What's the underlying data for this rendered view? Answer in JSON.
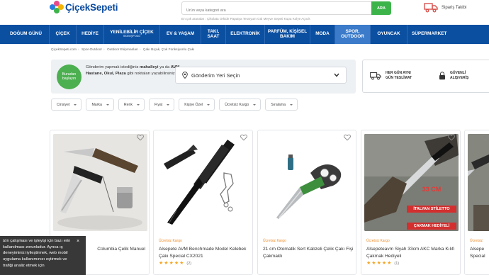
{
  "header": {
    "logo_text": "ÇiçekSepeti",
    "search_placeholder": "Ürün veya kategori ara",
    "search_button": "ARA",
    "recent_searches": "En çok aranalar : Çikolata Orkide Papatya Teraryum Gül Meyve Sepeti Kupa Kolye Açıcık",
    "order_tracking": "Sipariş Takibi"
  },
  "nav": {
    "items": [
      {
        "label": "DOĞUM GÜNÜ",
        "sub": ""
      },
      {
        "label": "ÇİÇEK",
        "sub": ""
      },
      {
        "label": "HEDİYE",
        "sub": ""
      },
      {
        "label": "YENİLEBİLİR ÇİÇEK",
        "sub": "BonnyFood"
      },
      {
        "label": "EV & YAŞAM",
        "sub": ""
      },
      {
        "label": "TAKI, SAAT",
        "sub": ""
      },
      {
        "label": "ELEKTRONİK",
        "sub": ""
      },
      {
        "label": "PARFÜM, KİŞİSEL BAKIM",
        "sub": ""
      },
      {
        "label": "MODA",
        "sub": ""
      },
      {
        "label": "SPOR, OUTDOOR",
        "sub": ""
      },
      {
        "label": "OYUNCAK",
        "sub": ""
      },
      {
        "label": "SÜPERMARKET",
        "sub": ""
      }
    ],
    "active_index": 9,
    "colors": {
      "bar": "#0b4fa1",
      "active": "#3b7bc9"
    }
  },
  "breadcrumb": [
    "ÇiçekSepeti.com",
    "Spor-Outdoor",
    "Outdoor Ekipmanları",
    "Çakı Bıçak, Çok Fonksiyonlu Çakı"
  ],
  "delivery": {
    "badge": "Buradan başlayın",
    "text_1": "Gönderim yapmak istediğiniz ",
    "text_bold_1": "mahalleyi",
    "text_2": " ya da ",
    "text_bold_2": "AVM, Hastane, Okul, Plaza",
    "text_3": " gibi noktaları yazabilirsiniz.",
    "location_placeholder": "Gönderim Yeri Seçin"
  },
  "features": {
    "same_day": "HER GÜN AYNI GÜN TESLİMAT",
    "secure": "GÜVENLİ ALIŞVERİŞ"
  },
  "filters": [
    "Cinsiyet",
    "Marka",
    "Renk",
    "Fiyat",
    "Kişiye Özel",
    "Ücretsiz Kargo",
    "Sıralama"
  ],
  "products": [
    {
      "shipping": "",
      "title": "Columbia Çelik Manuel",
      "rating": 0,
      "reviews": ""
    },
    {
      "shipping": "Ücretsiz Kargo",
      "title": "Alsepete AVM Benchmade Model Kelebek Çakı Special CX2021",
      "rating": 5,
      "reviews": "(2)"
    },
    {
      "shipping": "Ücretsiz Kargo",
      "title": "21 cm Otomatik Sert Kabzeli Çelik Çakı Fişi Çakmaklı",
      "rating": 0,
      "reviews": ""
    },
    {
      "shipping": "Ücretsiz Kargo",
      "title": "Alsepeteavm Siyah 33cm AKC Marka Kılıfı Çakmak Hediyeli",
      "rating": 5,
      "reviews": "(1)"
    },
    {
      "shipping": "Ücretsiz",
      "title": "Alsepe Special",
      "rating": 0,
      "reviews": ""
    }
  ],
  "product_image_text": {
    "p4_line1": "33 CM",
    "p4_line2": "İTALYAN STİLETTO",
    "p4_line3": "ÇAKMAK HEDİYELİ"
  },
  "cookie": {
    "text": "izin çalışması ve işleyişi için bazı erin kullanılması zorunludur. Ayrıca ış deneyiminizi iyileştirmek, web mobil uygulama kullanımınızı eştirmek ve trafiği analiz etmek için",
    "close": "×"
  },
  "colors": {
    "brand_blue": "#0b4fa1",
    "green": "#3cb44a",
    "star": "#f5a623",
    "shipping_orange": "#ef8d2c"
  }
}
